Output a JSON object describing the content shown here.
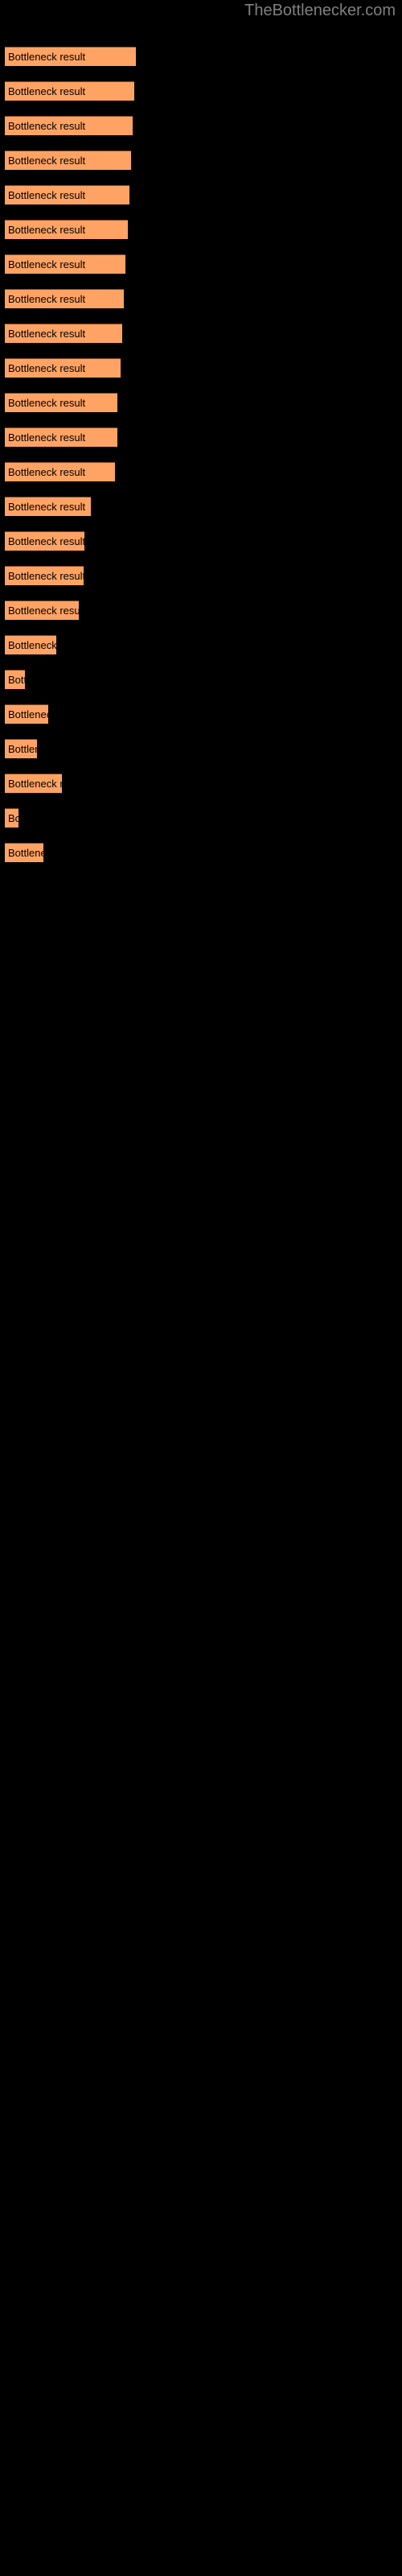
{
  "site": {
    "title": "TheBottlenecker.com",
    "title_color": "#808080"
  },
  "theme": {
    "background": "#000000",
    "bar_fill": "#ffa364",
    "bar_border": "#8a4a1e",
    "bar_label_color": "#000000"
  },
  "chart_data": {
    "type": "bar",
    "orientation": "horizontal",
    "title": "",
    "xlabel": "",
    "ylabel": "",
    "grid": false,
    "legend": false,
    "bar_label": "Bottleneck result",
    "categories": [
      "Bottleneck result",
      "Bottleneck result",
      "Bottleneck result",
      "Bottleneck result",
      "Bottleneck result",
      "Bottleneck result",
      "Bottleneck result",
      "Bottleneck result",
      "Bottleneck result",
      "Bottleneck result",
      "Bottleneck result",
      "Bottleneck result",
      "Bottleneck result",
      "Bottleneck result",
      "Bottleneck result",
      "Bottleneck result",
      "Bottleneck result",
      "Bottleneck result",
      "Bottleneck result",
      "Bottleneck result",
      "Bottleneck result",
      "Bottleneck result",
      "Bottleneck result",
      "Bottleneck result"
    ],
    "values": [
      163,
      161,
      159,
      157,
      155,
      153,
      150,
      148,
      146,
      144,
      140,
      140,
      137,
      107,
      99,
      98,
      92,
      64,
      25,
      54,
      40,
      71,
      17,
      48
    ],
    "xlim": [
      0,
      500
    ]
  },
  "bars": [
    {
      "label": "Bottleneck result",
      "width": 163,
      "top": 58
    },
    {
      "label": "Bottleneck result",
      "width": 161,
      "top": 101
    },
    {
      "label": "Bottleneck result",
      "width": 159,
      "top": 144
    },
    {
      "label": "Bottleneck result",
      "width": 157,
      "top": 187
    },
    {
      "label": "Bottleneck result",
      "width": 155,
      "top": 230
    },
    {
      "label": "Bottleneck result",
      "width": 153,
      "top": 273
    },
    {
      "label": "Bottleneck result",
      "width": 150,
      "top": 316
    },
    {
      "label": "Bottleneck result",
      "width": 148,
      "top": 359
    },
    {
      "label": "Bottleneck result",
      "width": 146,
      "top": 402
    },
    {
      "label": "Bottleneck result",
      "width": 144,
      "top": 445
    },
    {
      "label": "Bottleneck result",
      "width": 140,
      "top": 488
    },
    {
      "label": "Bottleneck result",
      "width": 140,
      "top": 531
    },
    {
      "label": "Bottleneck result",
      "width": 137,
      "top": 574
    },
    {
      "label": "Bottleneck result",
      "width": 107,
      "top": 617
    },
    {
      "label": "Bottleneck result",
      "width": 99,
      "top": 660
    },
    {
      "label": "Bottleneck result",
      "width": 98,
      "top": 703
    },
    {
      "label": "Bottleneck result",
      "width": 92,
      "top": 746
    },
    {
      "label": "Bottleneck result",
      "width": 64,
      "top": 789
    },
    {
      "label": "Bottleneck result",
      "width": 25,
      "top": 832
    },
    {
      "label": "Bottleneck result",
      "width": 54,
      "top": 875
    },
    {
      "label": "Bottleneck result",
      "width": 40,
      "top": 918
    },
    {
      "label": "Bottleneck result",
      "width": 71,
      "top": 961
    },
    {
      "label": "Bottleneck result",
      "width": 17,
      "top": 1004
    },
    {
      "label": "Bottleneck result",
      "width": 48,
      "top": 1047
    }
  ]
}
